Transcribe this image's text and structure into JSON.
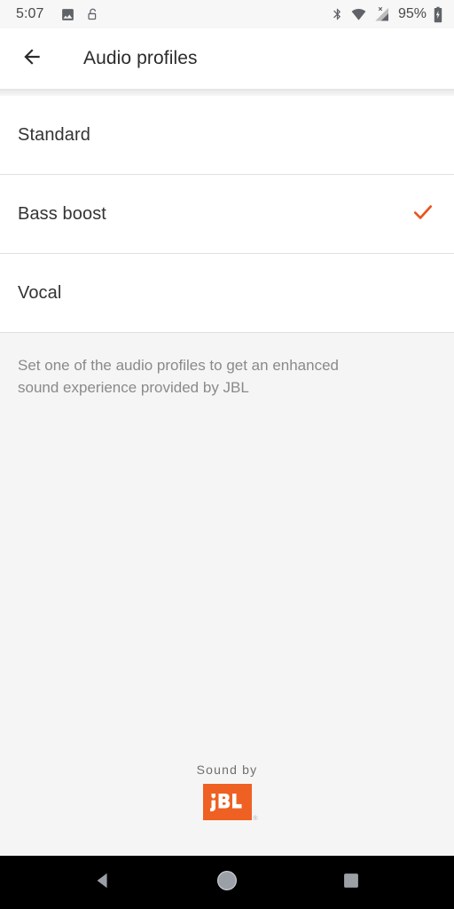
{
  "status_bar": {
    "clock": "5:07",
    "battery_percent": "95%",
    "left_icons": [
      {
        "name": "screenshot-image-icon"
      },
      {
        "name": "unlocked-padlock-icon"
      }
    ],
    "right_icons": [
      {
        "name": "bluetooth-icon"
      },
      {
        "name": "wifi-icon"
      },
      {
        "name": "cellular-no-service-icon"
      },
      {
        "name": "battery-charging-icon"
      }
    ]
  },
  "app_bar": {
    "back_icon": "arrow-left-icon",
    "title": "Audio profiles"
  },
  "options": [
    {
      "label": "Standard",
      "selected": false
    },
    {
      "label": "Bass boost",
      "selected": true
    },
    {
      "label": "Vocal",
      "selected": false
    }
  ],
  "footer": {
    "description": "Set one of the audio profiles to get an enhanced sound experience provided by JBL",
    "brand_caption": "Sound by",
    "brand_name": "JBL",
    "brand_registered_mark": "®"
  },
  "nav_bar": {
    "back": "nav-back-icon",
    "home": "nav-home-icon",
    "recents": "nav-recents-icon"
  },
  "colors": {
    "accent": "#e8561f",
    "brand_orange": "#ee6123",
    "page_background": "#f5f5f5",
    "row_background": "#ffffff",
    "divider": "#e0e0e0",
    "primary_text": "#333333",
    "secondary_text": "#8a8a8a"
  }
}
